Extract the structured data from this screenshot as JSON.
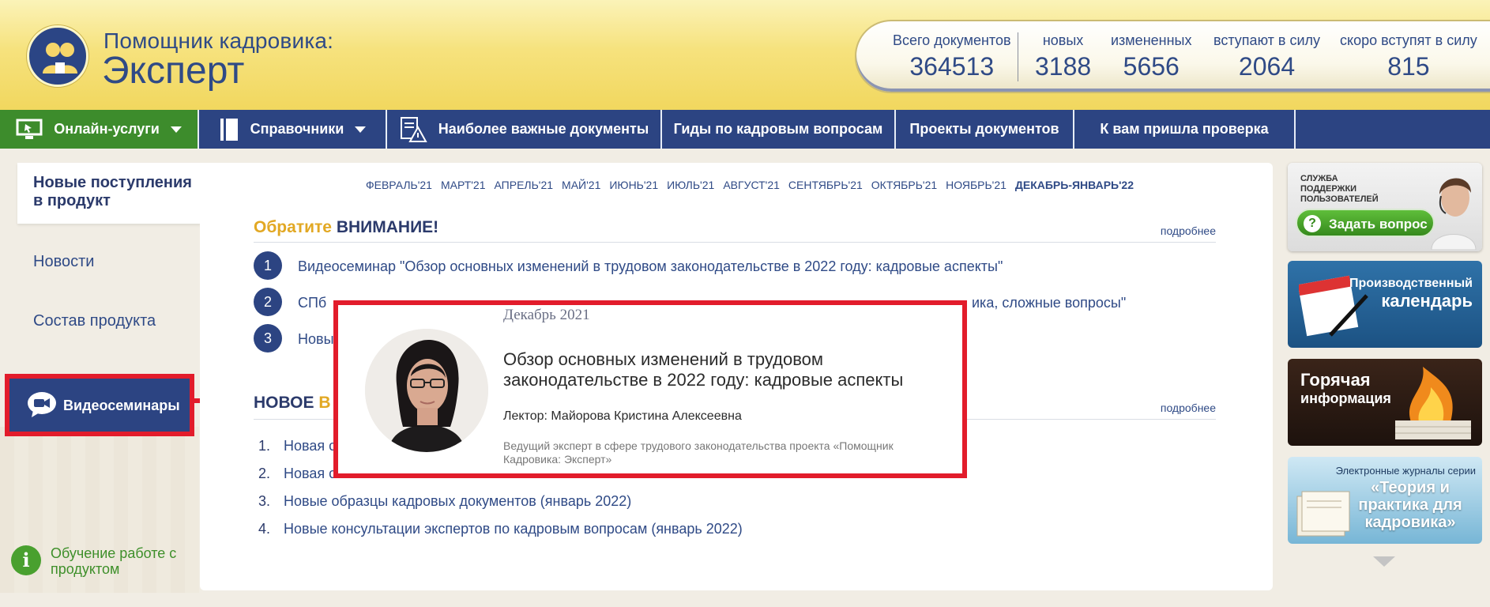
{
  "header": {
    "logo_subtitle": "Помощник кадровика:",
    "logo_title": "Эксперт",
    "stats": [
      {
        "label": "Всего документов",
        "value": "364513"
      },
      {
        "label": "новых",
        "value": "3188"
      },
      {
        "label": "измененных",
        "value": "5656"
      },
      {
        "label": "вступают в силу",
        "value": "2064"
      },
      {
        "label": "скоро вступят в силу",
        "value": "815"
      }
    ]
  },
  "nav": {
    "online": "Онлайн-услуги",
    "reference": "Справочники",
    "important": "Наиболее важные документы",
    "guides": "Гиды по кадровым вопросам",
    "drafts": "Проекты документов",
    "inspection": "К вам пришла проверка"
  },
  "sidebar": {
    "active": "Новые поступления в продукт",
    "news": "Новости",
    "composition": "Состав продукта",
    "webinars": "Видеосеминары",
    "learn": "Обучение работе с продуктом"
  },
  "months": [
    "ФЕВРАЛЬ'21",
    "МАРТ'21",
    "АПРЕЛЬ'21",
    "МАЙ'21",
    "ИЮНЬ'21",
    "ИЮЛЬ'21",
    "АВГУСТ'21",
    "СЕНТЯБРЬ'21",
    "ОКТЯБРЬ'21",
    "НОЯБРЬ'21",
    "ДЕКАБРЬ-ЯНВАРЬ'22"
  ],
  "attention": {
    "title_hl": "Обратите",
    "title_dk": "ВНИМАНИЕ!",
    "more": "подробнее",
    "items": [
      {
        "num": "1",
        "text": "Видеосеминар \"Обзор основных изменений в трудовом законодательстве в 2022 году: кадровые аспекты\""
      },
      {
        "num": "2",
        "text": "СПб",
        "tail": "ика, сложные вопросы\""
      },
      {
        "num": "3",
        "text": "Новы"
      }
    ]
  },
  "new_section": {
    "title_dk": "НОВОЕ",
    "title_hl": "В",
    "more": "подробнее",
    "items": [
      {
        "num": "1.",
        "text": "Новая с"
      },
      {
        "num": "2.",
        "text": "Новая с"
      },
      {
        "num": "3.",
        "text": "Новые образцы кадровых документов (январь 2022)"
      },
      {
        "num": "4.",
        "text": "Новые консультации экспертов по кадровым вопросам (январь 2022)"
      }
    ]
  },
  "popup": {
    "date": "Декабрь 2021",
    "title": "Обзор основных изменений в трудовом законодательстве в 2022 году: кадровые аспекты",
    "lector": "Лектор: Майорова Кристина Алексеевна",
    "description": "Ведущий эксперт в сфере трудового законодательства проекта «Помощник Кадровика: Эксперт»"
  },
  "right_panel": {
    "support_small": "СЛУЖБА ПОДДЕРЖКИ ПОЛЬЗОВАТЕЛЕЙ",
    "ask": "Задать вопрос",
    "calendar_1": "Производственный",
    "calendar_2": "календарь",
    "hot_1": "Горячая",
    "hot_2": "информация",
    "journals_1": "Электронные журналы серии",
    "journals_2": "«Теория и практика для кадровика»"
  },
  "colors": {
    "brand_blue": "#2c4482",
    "accent_green": "#3d8c2c",
    "highlight_red": "#e21c2b",
    "attention_yellow": "#e2a823"
  }
}
